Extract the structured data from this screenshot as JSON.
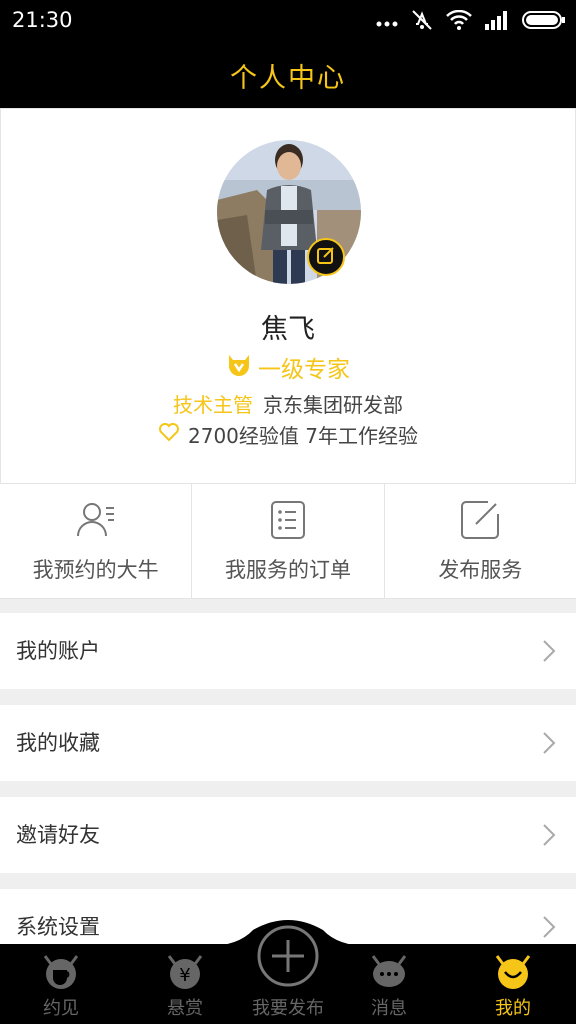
{
  "status_bar": {
    "time": "21:30"
  },
  "header": {
    "title": "个人中心"
  },
  "profile": {
    "name": "焦飞",
    "level": "一级专家",
    "job_title": "技术主管",
    "company": "京东集团研发部",
    "experience": "2700经验值 7年工作经验"
  },
  "quick_actions": [
    {
      "label": "我预约的大牛",
      "icon": "user-list-icon"
    },
    {
      "label": "我服务的订单",
      "icon": "order-list-icon"
    },
    {
      "label": "发布服务",
      "icon": "edit-icon"
    }
  ],
  "menu": [
    {
      "label": "我的账户"
    },
    {
      "label": "我的收藏"
    },
    {
      "label": "邀请好友"
    },
    {
      "label": "系统设置"
    }
  ],
  "tabs": [
    {
      "label": "约见",
      "icon": "coffee-devil-icon",
      "active": false
    },
    {
      "label": "悬赏",
      "icon": "yen-devil-icon",
      "active": false
    },
    {
      "label": "我要发布",
      "icon": "plus-circle-icon",
      "active": false
    },
    {
      "label": "消息",
      "icon": "chat-devil-icon",
      "active": false
    },
    {
      "label": "我的",
      "icon": "smile-devil-icon",
      "active": true
    }
  ],
  "colors": {
    "accent": "#f5c518",
    "bar": "#000000",
    "background": "#efefef"
  }
}
